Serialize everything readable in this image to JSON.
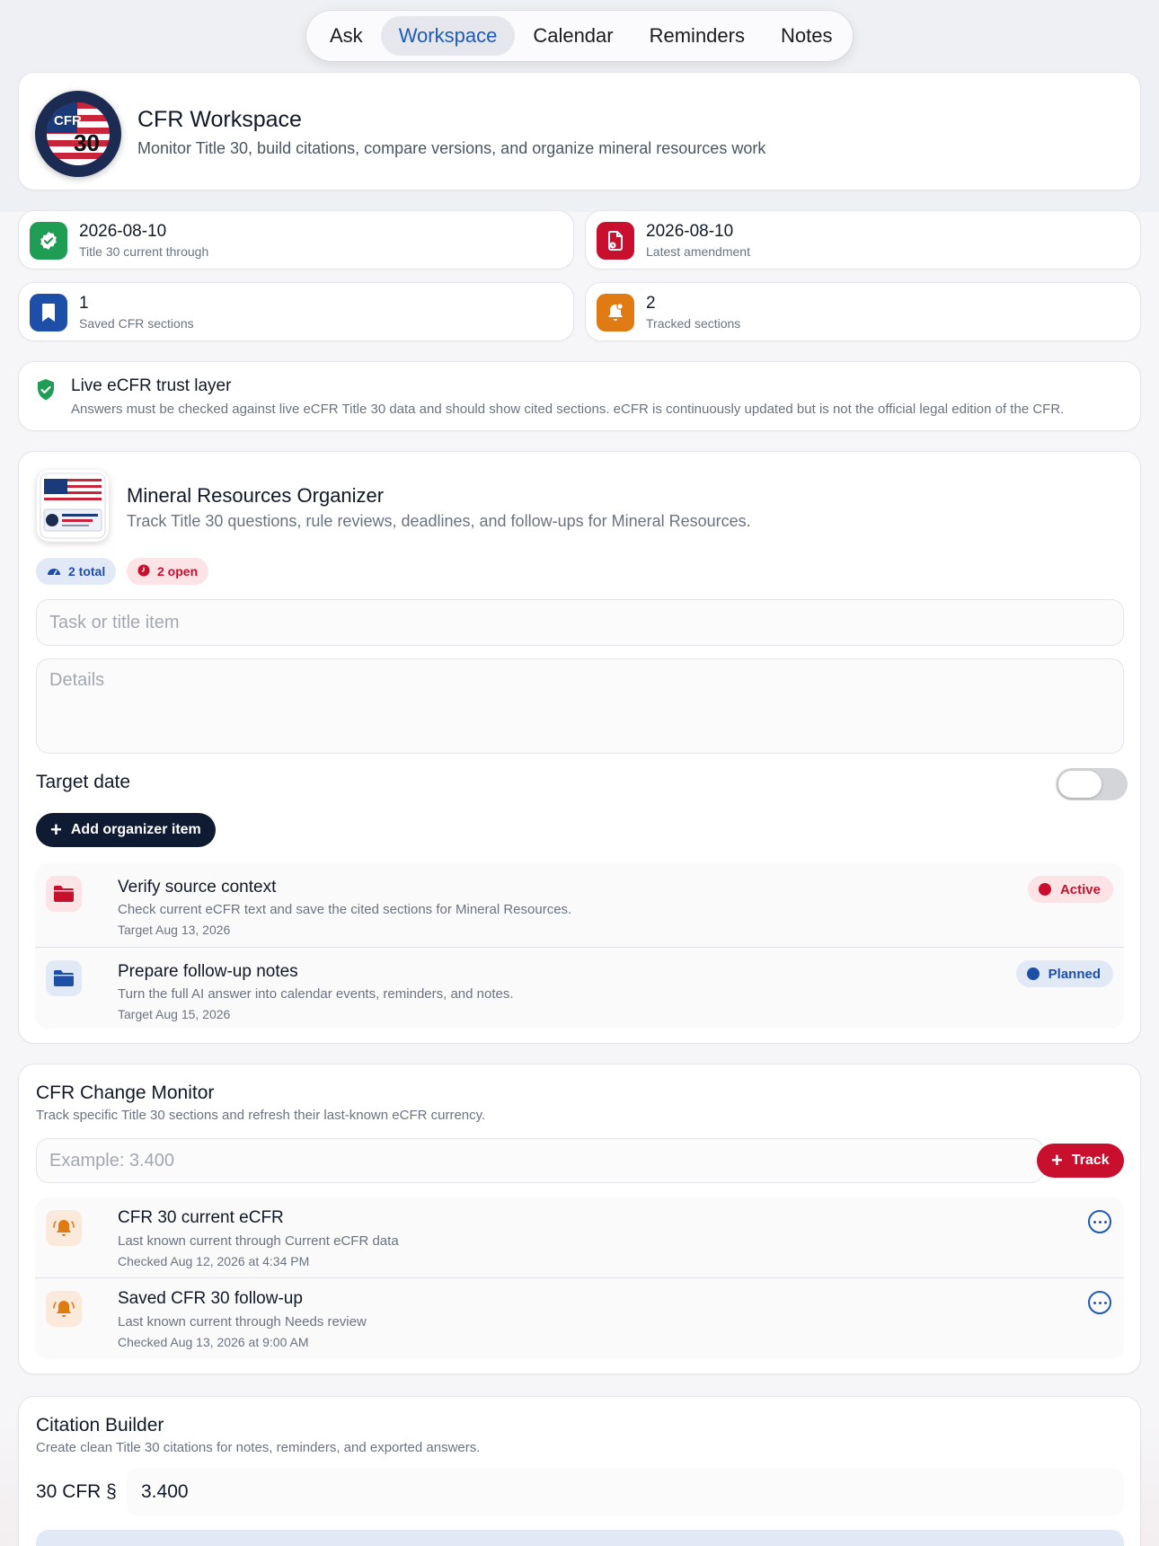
{
  "nav": {
    "tabs": [
      {
        "label": "Ask"
      },
      {
        "label": "Workspace"
      },
      {
        "label": "Calendar"
      },
      {
        "label": "Reminders"
      },
      {
        "label": "Notes"
      }
    ],
    "active": "Workspace"
  },
  "header": {
    "seal_text": "CFR",
    "seal_number": "30",
    "title": "CFR Workspace",
    "subtitle": "Monitor Title 30, build citations, compare versions, and organize mineral resources work"
  },
  "stats": [
    {
      "value": "2026-08-10",
      "label": "Title 30 current through",
      "icon": "verified-badge-icon",
      "color": "#1f9d55"
    },
    {
      "value": "2026-08-10",
      "label": "Latest amendment",
      "icon": "document-clock-icon",
      "color": "#c8102e"
    },
    {
      "value": "1",
      "label": "Saved CFR sections",
      "icon": "bookmark-icon",
      "color": "#1e4fa8"
    },
    {
      "value": "2",
      "label": "Tracked sections",
      "icon": "bell-badge-icon",
      "color": "#e07b14"
    }
  ],
  "trust": {
    "title": "Live eCFR trust layer",
    "text": "Answers must be checked against live eCFR Title 30 data and should show cited sections. eCFR is continuously updated but is not the official legal edition of the CFR.",
    "icon": "shield-check-icon"
  },
  "organizer": {
    "title": "Mineral Resources Organizer",
    "subtitle": "Track Title 30 questions, rule reviews, deadlines, and follow-ups for Mineral Resources.",
    "total_badge": "2 total",
    "open_badge": "2 open",
    "task_placeholder": "Task or title item",
    "details_placeholder": "Details",
    "target_date_label": "Target date",
    "target_date_enabled": false,
    "add_button": "Add organizer item",
    "items": [
      {
        "title": "Verify source context",
        "detail": "Check current eCFR text and save the cited sections for Mineral Resources.",
        "target": "Target Aug 13, 2026",
        "status": "Active",
        "status_color": "#c8102e",
        "icon": "folder-icon"
      },
      {
        "title": "Prepare follow-up notes",
        "detail": "Turn the full AI answer into calendar events, reminders, and notes.",
        "target": "Target Aug 15, 2026",
        "status": "Planned",
        "status_color": "#1e4fa8",
        "icon": "folder-icon"
      }
    ]
  },
  "monitor": {
    "title": "CFR Change Monitor",
    "subtitle": "Track specific Title 30 sections and refresh their last-known eCFR currency.",
    "placeholder": "Example: 3.400",
    "track_button": "Track",
    "items": [
      {
        "title": "CFR 30 current eCFR",
        "detail": "Last known current through Current eCFR data",
        "checked": "Checked Aug 12, 2026 at 4:34 PM"
      },
      {
        "title": "Saved CFR 30 follow-up",
        "detail": "Last known current through Needs review",
        "checked": "Checked Aug 13, 2026 at 9:00 AM"
      }
    ]
  },
  "citation": {
    "title": "Citation Builder",
    "subtitle": "Create clean Title 30 citations for notes, reminders, and exported answers.",
    "prefix": "30 CFR §",
    "section_value": "3.400"
  }
}
